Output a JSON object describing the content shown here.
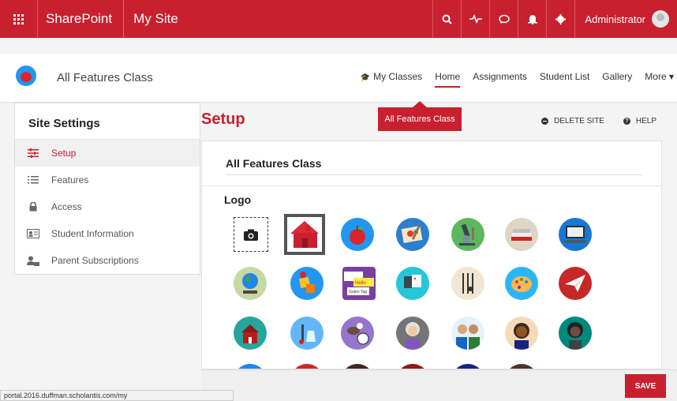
{
  "suitebar": {
    "brand": "SharePoint",
    "site_link": "My Site",
    "user": "Administrator",
    "icons": [
      "search-icon",
      "activity-icon",
      "chat-icon",
      "bell-icon",
      "gear-icon"
    ],
    "color": "#c8202f"
  },
  "site": {
    "title": "All Features Class",
    "nav": [
      {
        "label": "My Classes",
        "icon": "graduation-cap-icon"
      },
      {
        "label": "Home",
        "active": true
      },
      {
        "label": "Assignments"
      },
      {
        "label": "Student List"
      },
      {
        "label": "Gallery"
      },
      {
        "label": "More ▾"
      }
    ],
    "classes_dropdown": "All Features Class"
  },
  "settings": {
    "title": "Site Settings",
    "items": [
      {
        "label": "Setup",
        "icon": "sliders-icon",
        "active": true
      },
      {
        "label": "Features",
        "icon": "list-icon"
      },
      {
        "label": "Access",
        "icon": "lock-icon"
      },
      {
        "label": "Student Information",
        "icon": "id-card-icon"
      },
      {
        "label": "Parent Subscriptions",
        "icon": "users-icon"
      }
    ]
  },
  "main": {
    "title": "Setup",
    "delete_label": "DELETE SITE",
    "help_label": "HELP",
    "card_title": "All Features Class",
    "logo_label": "Logo",
    "logos": [
      "camera-upload-icon",
      "schoolhouse-icon",
      "apple-icon",
      "painting-icon",
      "microscope-icon",
      "books-icon",
      "computer-icon",
      "globe-icon",
      "abc-blocks-icon",
      "speech-bubbles-icon",
      "calculator-icon",
      "music-notes-icon",
      "palette-icon",
      "paper-plane-icon",
      "school-building-icon",
      "lab-equipment-icon",
      "sports-balls-icon",
      "grandma-avatar-icon",
      "family-avatar-icon",
      "woman-avatar-icon",
      "girl-avatar-icon"
    ],
    "speech_texts": [
      "Hello",
      "Guten Tag"
    ],
    "save_label": "SAVE"
  },
  "status_url": "portal.2016.duffman.scholantis.com/my"
}
